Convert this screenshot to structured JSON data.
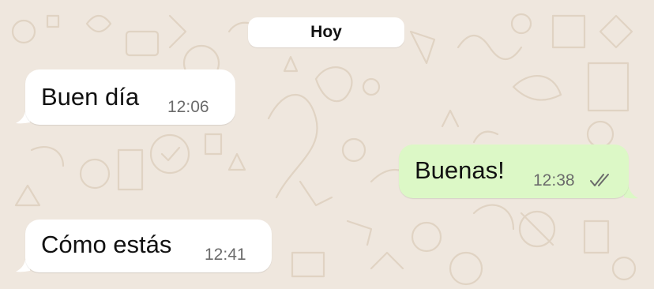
{
  "colors": {
    "wallpaper": "#efe7de",
    "doodle": "#e2d6c7",
    "incoming_bubble": "#ffffff",
    "outgoing_bubble": "#dcf8c6",
    "time_text": "#6b6b6b",
    "read_ticks": "#6b6b6b"
  },
  "date_separator": {
    "label": "Hoy"
  },
  "messages": [
    {
      "direction": "incoming",
      "text": "Buen día",
      "time": "12:06"
    },
    {
      "direction": "outgoing",
      "text": "Buenas!",
      "time": "12:38",
      "status_icon": "double-check-icon"
    },
    {
      "direction": "incoming",
      "text": "Cómo estás",
      "time": "12:41"
    }
  ]
}
